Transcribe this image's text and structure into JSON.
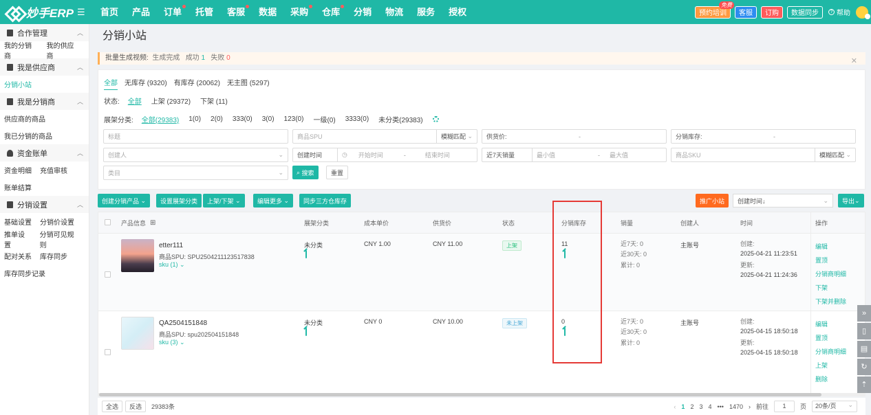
{
  "brand": {
    "name": "妙手ERP"
  },
  "nav": [
    {
      "label": "首页",
      "dot": false
    },
    {
      "label": "产品",
      "dot": false
    },
    {
      "label": "订单",
      "dot": true
    },
    {
      "label": "托管",
      "dot": false
    },
    {
      "label": "客服",
      "dot": true
    },
    {
      "label": "数据",
      "dot": false
    },
    {
      "label": "采购",
      "dot": true
    },
    {
      "label": "仓库",
      "dot": true
    },
    {
      "label": "分销",
      "dot": false
    },
    {
      "label": "物流",
      "dot": false
    },
    {
      "label": "服务",
      "dot": false
    },
    {
      "label": "授权",
      "dot": false
    }
  ],
  "topright": {
    "training": "预约培训",
    "free_badge": "免费",
    "service": "客服",
    "order": "订购",
    "sync": "数据同步",
    "help": "帮助"
  },
  "sidebar": {
    "g1": "合作管理",
    "g1_items": [
      "我的分销商",
      "我的供应商"
    ],
    "g2": "我是供应商",
    "g2_items": [
      "分销小站"
    ],
    "g3": "我是分销商",
    "g3_items": [
      "供应商的商品",
      "我已分销的商品"
    ],
    "g4": "资金账单",
    "g4_row1": [
      "资金明细",
      "充值审核"
    ],
    "g4_row2": [
      "账单结算"
    ],
    "g5": "分销设置",
    "g5_row1": [
      "基础设置",
      "分销价设置"
    ],
    "g5_row2": [
      "推单设置",
      "分销可见规则"
    ],
    "g5_row3": [
      "配对关系",
      "库存同步"
    ],
    "g5_row4": [
      "库存同步记录"
    ]
  },
  "page": {
    "title": "分销小站"
  },
  "notice": {
    "prefix": "批量生成视频:",
    "status": "生成完成",
    "success_label": "成功",
    "success_count": "1",
    "fail_label": "失败",
    "fail_count": "0"
  },
  "tabs": [
    "全部",
    "无库存 (9320)",
    "有库存 (20062)",
    "无主图 (5297)"
  ],
  "status_filter": {
    "label": "状态:",
    "options": [
      "全部",
      "上架 (29372)",
      "下架 (11)"
    ]
  },
  "shelf_filter": {
    "label": "展架分类:",
    "options": [
      "全部(29383)",
      "1(0)",
      "2(0)",
      "333(0)",
      "3(0)",
      "123(0)",
      "一级(0)",
      "3333(0)",
      "未分类(29383)"
    ]
  },
  "fields": {
    "title_placeholder": "标题",
    "spu_placeholder": "商品SPU",
    "fuzzy": "模糊匹配",
    "supply_price": "供货价:",
    "dist_stock": "分销库存:",
    "dash": "-",
    "creator": "创建人",
    "create_time": "创建时间",
    "start_time": "开始时间",
    "end_time": "结束时间",
    "sales7": "近7天销量",
    "min": "最小值",
    "max": "最大值",
    "sku_placeholder": "商品SKU",
    "category": "类目",
    "search": "搜索",
    "reset": "重置"
  },
  "actions": {
    "create": "创建分销产品",
    "set_shelf": "设置展架分类",
    "on_off": "上架/下架",
    "edit_more": "编辑更多",
    "sync_stock": "同步三方仓库存",
    "promote": "推广小站",
    "sort": "创建时间↓",
    "export": "导出"
  },
  "table": {
    "headers": [
      "产品信息",
      "展架分类",
      "成本单价",
      "供货价",
      "状态",
      "分销库存",
      "销量",
      "创建人",
      "时间",
      "操作"
    ],
    "rows": [
      {
        "name": "etter111",
        "spu_label": "商品SPU:",
        "spu": "SPU2504211123517838",
        "sku": "sku (1)",
        "shelf": "未分类",
        "cost": "CNY 1.00",
        "supply": "CNY 11.00",
        "status": "上架",
        "stock": "11",
        "sales7": "近7天: 0",
        "sales30": "近30天: 0",
        "sales_total": "累计: 0",
        "creator": "主账号",
        "created_label": "创建:",
        "created": "2025-04-21 11:23:51",
        "updated_label": "更新:",
        "updated": "2025-04-21 11:24:36",
        "ops": [
          "编辑",
          "置顶",
          "分销商明细",
          "下架",
          "下架并删除"
        ]
      },
      {
        "name": "QA2504151848",
        "spu_label": "商品SPU:",
        "spu": "spu202504151848",
        "sku": "sku (3)",
        "shelf": "未分类",
        "cost": "CNY 0",
        "supply": "CNY 10.00",
        "status": "未上架",
        "stock": "0",
        "sales7": "近7天: 0",
        "sales30": "近30天: 0",
        "sales_total": "累计: 0",
        "creator": "主账号",
        "created_label": "创建:",
        "created": "2025-04-15 18:50:18",
        "updated_label": "更新:",
        "updated": "2025-04-15 18:50:18",
        "ops": [
          "编辑",
          "置顶",
          "分销商明细",
          "上架",
          "删除"
        ]
      }
    ]
  },
  "footer": {
    "select_all": "全选",
    "invert": "反选",
    "count": "29383条",
    "pages": [
      "1",
      "2",
      "3",
      "4"
    ],
    "ellipsis": "•••",
    "last": "1470",
    "goto": "前往",
    "page_input": "1",
    "page_unit": "页",
    "page_size": "20条/页"
  },
  "colors": {
    "primary": "#1fb8a6",
    "highlight": "#e53935"
  }
}
